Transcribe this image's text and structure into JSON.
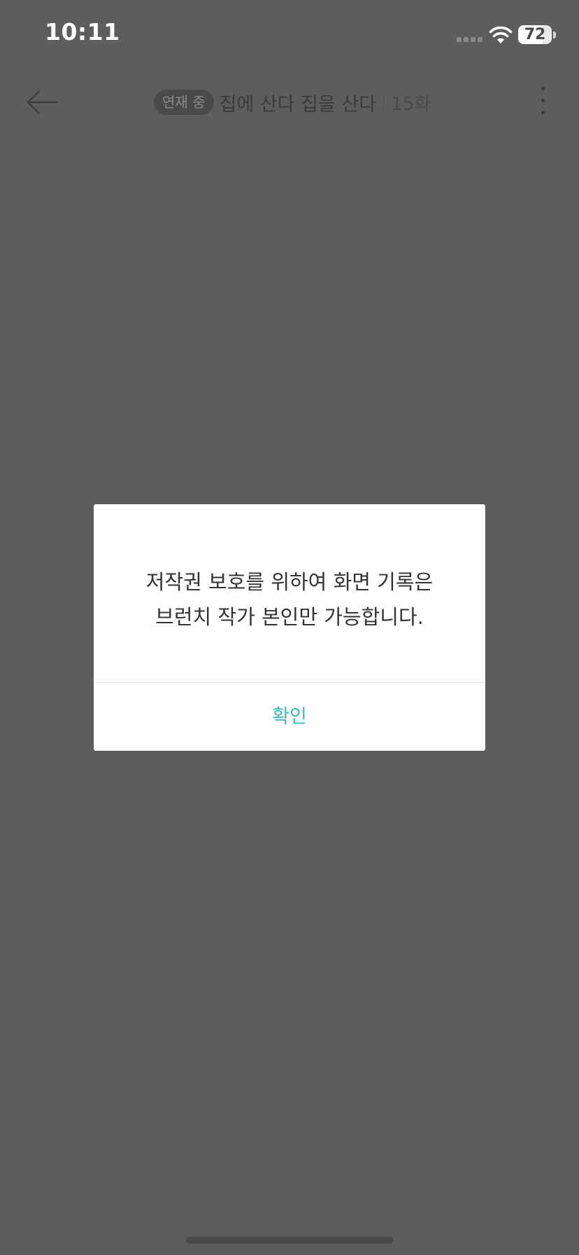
{
  "status_bar": {
    "time": "10:11",
    "battery_level": "72",
    "battery_fraction": 0.72,
    "signal": "no-service-dots",
    "wifi": "wifi-full"
  },
  "nav": {
    "back_icon": "arrow-left-icon",
    "status_badge": "연재 중",
    "book_title": "집에 산다 집을 산다",
    "episode": "15화",
    "more_icon": "more-vertical-icon"
  },
  "dialog": {
    "message_line1": "저작권 보호를 위하여 화면 기록은",
    "message_line2": "브런치 작가 본인만 가능합니다.",
    "confirm_label": "확인",
    "accent_color": "#36bdb7"
  },
  "colors": {
    "overlay_background": "#5d5d5d",
    "dialog_background": "#ffffff"
  }
}
